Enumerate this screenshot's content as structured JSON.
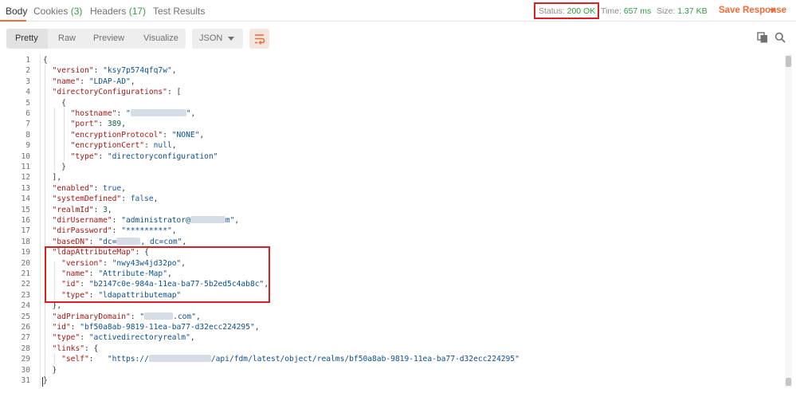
{
  "tabs": [
    {
      "label": "Body",
      "count": ""
    },
    {
      "label": "Cookies",
      "count": "(3)"
    },
    {
      "label": "Headers",
      "count": "(17)"
    },
    {
      "label": "Test Results",
      "count": ""
    }
  ],
  "status": {
    "label": "Status:",
    "value": "200 OK"
  },
  "time": {
    "label": "Time:",
    "value": "657 ms"
  },
  "size": {
    "label": "Size:",
    "value": "1.37 KB"
  },
  "save_response": "Save Response",
  "toolbar": {
    "view_modes": [
      "Pretty",
      "Raw",
      "Preview",
      "Visualize"
    ],
    "format": "JSON"
  },
  "icons": {
    "wrap": "wrap-lines-icon",
    "copy": "copy-icon",
    "search": "search-icon",
    "caret": "chevron-down-icon"
  },
  "colors": {
    "accent": "#f26b3a",
    "status_ok": "#2f9e44",
    "highlight": "#d92027",
    "json_key": "#a31515",
    "json_string": "#0b4f8a"
  },
  "code_lines": [
    [
      [
        "p",
        "{"
      ]
    ],
    [
      [
        "p",
        "  "
      ],
      [
        "k",
        "\"version\""
      ],
      [
        "p",
        ": "
      ],
      [
        "s",
        "\"ksy7p574qfq7w\""
      ],
      [
        "p",
        ","
      ]
    ],
    [
      [
        "p",
        "  "
      ],
      [
        "k",
        "\"name\""
      ],
      [
        "p",
        ": "
      ],
      [
        "s",
        "\"LDAP-AD\""
      ],
      [
        "p",
        ","
      ]
    ],
    [
      [
        "p",
        "  "
      ],
      [
        "k",
        "\"directoryConfigurations\""
      ],
      [
        "p",
        ": ["
      ]
    ],
    [
      [
        "p",
        "    {"
      ]
    ],
    [
      [
        "p",
        "      "
      ],
      [
        "k",
        "\"hostname\""
      ],
      [
        "p",
        ": "
      ],
      [
        "s",
        "\""
      ],
      [
        "blur",
        "70"
      ],
      [
        "s",
        "\""
      ],
      [
        "p",
        ","
      ]
    ],
    [
      [
        "p",
        "      "
      ],
      [
        "k",
        "\"port\""
      ],
      [
        "p",
        ": "
      ],
      [
        "n",
        "389"
      ],
      [
        "p",
        ","
      ]
    ],
    [
      [
        "p",
        "      "
      ],
      [
        "k",
        "\"encryptionProtocol\""
      ],
      [
        "p",
        ": "
      ],
      [
        "s",
        "\"NONE\""
      ],
      [
        "p",
        ","
      ]
    ],
    [
      [
        "p",
        "      "
      ],
      [
        "k",
        "\"encryptionCert\""
      ],
      [
        "p",
        ": "
      ],
      [
        "b",
        "null"
      ],
      [
        "p",
        ","
      ]
    ],
    [
      [
        "p",
        "      "
      ],
      [
        "k",
        "\"type\""
      ],
      [
        "p",
        ": "
      ],
      [
        "s",
        "\"directoryconfiguration\""
      ]
    ],
    [
      [
        "p",
        "    }"
      ]
    ],
    [
      [
        "p",
        "  ],"
      ]
    ],
    [
      [
        "p",
        "  "
      ],
      [
        "k",
        "\"enabled\""
      ],
      [
        "p",
        ": "
      ],
      [
        "b",
        "true"
      ],
      [
        "p",
        ","
      ]
    ],
    [
      [
        "p",
        "  "
      ],
      [
        "k",
        "\"systemDefined\""
      ],
      [
        "p",
        ": "
      ],
      [
        "b",
        "false"
      ],
      [
        "p",
        ","
      ]
    ],
    [
      [
        "p",
        "  "
      ],
      [
        "k",
        "\"realmId\""
      ],
      [
        "p",
        ": "
      ],
      [
        "n",
        "3"
      ],
      [
        "p",
        ","
      ]
    ],
    [
      [
        "p",
        "  "
      ],
      [
        "k",
        "\"dirUsername\""
      ],
      [
        "p",
        ": "
      ],
      [
        "s",
        "\"administrator@"
      ],
      [
        "blur",
        "44"
      ],
      [
        "s",
        "m\""
      ],
      [
        "p",
        ","
      ]
    ],
    [
      [
        "p",
        "  "
      ],
      [
        "k",
        "\"dirPassword\""
      ],
      [
        "p",
        ": "
      ],
      [
        "s",
        "\"*********\""
      ],
      [
        "p",
        ","
      ]
    ],
    [
      [
        "p",
        "  "
      ],
      [
        "k",
        "\"baseDN\""
      ],
      [
        "p",
        ": "
      ],
      [
        "s",
        "\"dc="
      ],
      [
        "blur",
        "30"
      ],
      [
        "s",
        ", dc=com\""
      ],
      [
        "p",
        ","
      ]
    ],
    [
      [
        "p",
        "  "
      ],
      [
        "k",
        "\"ldapAttributeMap\""
      ],
      [
        "p",
        ": {"
      ]
    ],
    [
      [
        "p",
        "    "
      ],
      [
        "k",
        "\"version\""
      ],
      [
        "p",
        ": "
      ],
      [
        "s",
        "\"nwy43w4jd32po\""
      ],
      [
        "p",
        ","
      ]
    ],
    [
      [
        "p",
        "    "
      ],
      [
        "k",
        "\"name\""
      ],
      [
        "p",
        ": "
      ],
      [
        "s",
        "\"Attribute-Map\""
      ],
      [
        "p",
        ","
      ]
    ],
    [
      [
        "p",
        "    "
      ],
      [
        "k",
        "\"id\""
      ],
      [
        "p",
        ": "
      ],
      [
        "s",
        "\"b2147c0e-984a-11ea-ba77-5b2ed5c4ab8c\""
      ],
      [
        "p",
        ","
      ]
    ],
    [
      [
        "p",
        "    "
      ],
      [
        "k",
        "\"type\""
      ],
      [
        "p",
        ": "
      ],
      [
        "s",
        "\"ldapattributemap\""
      ]
    ],
    [
      [
        "p",
        "  },"
      ]
    ],
    [
      [
        "p",
        "  "
      ],
      [
        "k",
        "\"adPrimaryDomain\""
      ],
      [
        "p",
        ": "
      ],
      [
        "s",
        "\""
      ],
      [
        "blur",
        "36"
      ],
      [
        "s",
        ".com\""
      ],
      [
        "p",
        ","
      ]
    ],
    [
      [
        "p",
        "  "
      ],
      [
        "k",
        "\"id\""
      ],
      [
        "p",
        ": "
      ],
      [
        "s",
        "\"bf50a8ab-9819-11ea-ba77-d32ecc224295\""
      ],
      [
        "p",
        ","
      ]
    ],
    [
      [
        "p",
        "  "
      ],
      [
        "k",
        "\"type\""
      ],
      [
        "p",
        ": "
      ],
      [
        "s",
        "\"activedirectoryrealm\""
      ],
      [
        "p",
        ","
      ]
    ],
    [
      [
        "p",
        "  "
      ],
      [
        "k",
        "\"links\""
      ],
      [
        "p",
        ": {"
      ]
    ],
    [
      [
        "p",
        "    "
      ],
      [
        "k",
        "\"self\""
      ],
      [
        "p",
        ":   "
      ],
      [
        "s",
        "\"https://"
      ],
      [
        "blur",
        "78"
      ],
      [
        "s",
        "/api/fdm/latest/object/realms/bf50a8ab-9819-11ea-ba77-d32ecc224295\""
      ]
    ],
    [
      [
        "p",
        "  }"
      ]
    ],
    [
      [
        "p",
        "}"
      ]
    ]
  ]
}
